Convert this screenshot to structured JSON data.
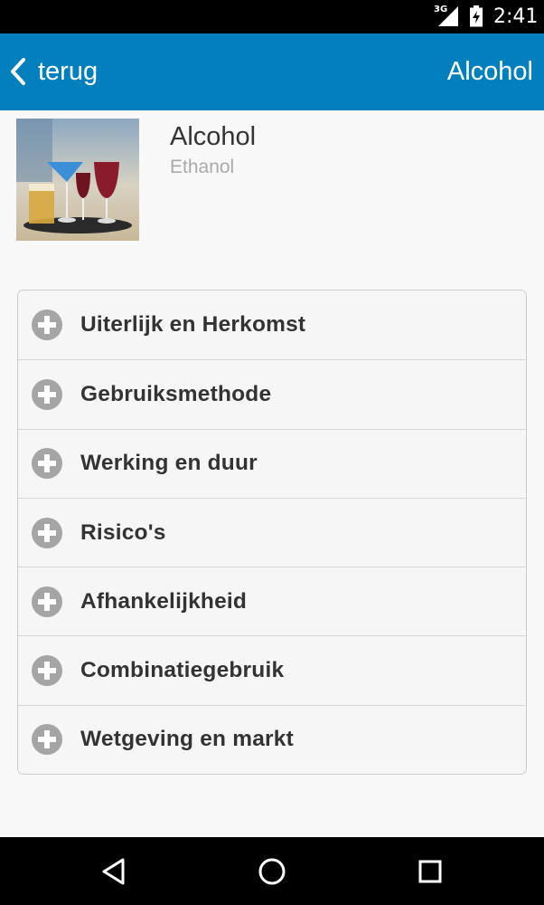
{
  "status_bar": {
    "network": "3G",
    "time": "2:41",
    "icons": [
      "signal-icon",
      "battery-icon"
    ]
  },
  "app_bar": {
    "back_label": "terug",
    "title": "Alcohol",
    "color": "#0280be"
  },
  "substance": {
    "name": "Alcohol",
    "subname": "Ethanol",
    "image": "drinks-photo"
  },
  "accordion": {
    "icon": "plus-circle-icon",
    "items": [
      {
        "label": "Uiterlijk en Herkomst"
      },
      {
        "label": "Gebruiksmethode"
      },
      {
        "label": "Werking en duur"
      },
      {
        "label": "Risico's"
      },
      {
        "label": "Afhankelijkheid"
      },
      {
        "label": "Combinatiegebruik"
      },
      {
        "label": "Wetgeving en markt"
      }
    ]
  },
  "nav_bar": {
    "icons": [
      "back-triangle-icon",
      "home-circle-icon",
      "recents-square-icon"
    ]
  }
}
